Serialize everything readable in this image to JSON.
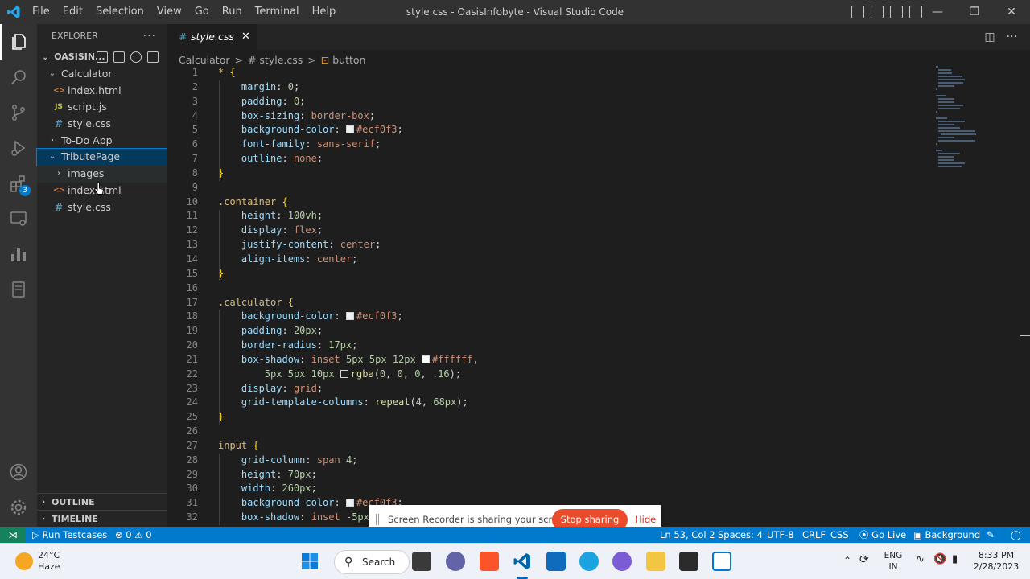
{
  "titlebar": {
    "menu": [
      "File",
      "Edit",
      "Selection",
      "View",
      "Go",
      "Run",
      "Terminal",
      "Help"
    ],
    "title": "style.css - OasisInfobyte - Visual Studio Code"
  },
  "activity_bar": {
    "extensions_badge": "3"
  },
  "explorer": {
    "header": "EXPLORER",
    "more": "···",
    "folder": "OASISIN...",
    "tree": [
      {
        "label": "Calculator",
        "type": "folder",
        "expanded": true
      },
      {
        "label": "index.html",
        "type": "html"
      },
      {
        "label": "script.js",
        "type": "js"
      },
      {
        "label": "style.css",
        "type": "css"
      },
      {
        "label": "To-Do App",
        "type": "folder",
        "expanded": false
      },
      {
        "label": "TributePage",
        "type": "folder",
        "expanded": true
      },
      {
        "label": "images",
        "type": "folder",
        "expanded": false
      },
      {
        "label": "index.html",
        "type": "html"
      },
      {
        "label": "style.css",
        "type": "css"
      }
    ],
    "icon_html": "<>",
    "icon_js": "JS",
    "icon_css": "#",
    "outline": "OUTLINE",
    "timeline": "TIMELINE"
  },
  "tab": {
    "icon": "#",
    "name": "style.css",
    "close": "✕"
  },
  "breadcrumb": {
    "items": [
      "Calculator",
      ">",
      "# style.css",
      ">",
      "button"
    ],
    "symbol_icon": "⊡"
  },
  "code_lines": [
    [
      "1",
      "* {"
    ],
    [
      "2",
      "    margin: 0;"
    ],
    [
      "3",
      "    padding: 0;"
    ],
    [
      "4",
      "    box-sizing: border-box;"
    ],
    [
      "5",
      "    background-color: #ecf0f3;"
    ],
    [
      "6",
      "    font-family: sans-serif;"
    ],
    [
      "7",
      "    outline: none;"
    ],
    [
      "8",
      "}"
    ],
    [
      "9",
      ""
    ],
    [
      "10",
      ".container {"
    ],
    [
      "11",
      "    height: 100vh;"
    ],
    [
      "12",
      "    display: flex;"
    ],
    [
      "13",
      "    justify-content: center;"
    ],
    [
      "14",
      "    align-items: center;"
    ],
    [
      "15",
      "}"
    ],
    [
      "16",
      ""
    ],
    [
      "17",
      ".calculator {"
    ],
    [
      "18",
      "    background-color: #ecf0f3;"
    ],
    [
      "19",
      "    padding: 20px;"
    ],
    [
      "20",
      "    border-radius: 17px;"
    ],
    [
      "21",
      "    box-shadow: inset 5px 5px 12px #ffffff,"
    ],
    [
      "22",
      "        5px 5px 10px rgba(0, 0, 0, .16);"
    ],
    [
      "23",
      "    display: grid;"
    ],
    [
      "24",
      "    grid-template-columns: repeat(4, 68px);"
    ],
    [
      "25",
      "}"
    ],
    [
      "26",
      ""
    ],
    [
      "27",
      "input {"
    ],
    [
      "28",
      "    grid-column: span 4;"
    ],
    [
      "29",
      "    height: 70px;"
    ],
    [
      "30",
      "    width: 260px;"
    ],
    [
      "31",
      "    background-color: #ecf0f3;"
    ],
    [
      "32",
      "    box-shadow: inset -5px"
    ]
  ],
  "screen_share": {
    "message": "Screen Recorder is sharing your screen.",
    "stop": "Stop sharing",
    "hide": "Hide"
  },
  "statusbar": {
    "remote": "⋊",
    "run_testcases": "Run Testcases",
    "problems": "⊗ 0 ⚠ 0",
    "position": "Ln 53, Col 2",
    "spaces": "Spaces: 4",
    "encoding": "UTF-8",
    "eol": "CRLF",
    "language": "CSS",
    "go_live": "Go Live",
    "background": "Background"
  },
  "taskbar": {
    "temperature": "24°C",
    "condition": "Haze",
    "search": "Search",
    "lang_top": "ENG",
    "lang_bottom": "IN",
    "time": "8:33 PM",
    "date": "2/28/2023"
  },
  "colors": {
    "accent": "#007acc",
    "stop_button": "#ea4c2b",
    "swatch_light": "#ecf0f3",
    "swatch_white": "#ffffff"
  }
}
